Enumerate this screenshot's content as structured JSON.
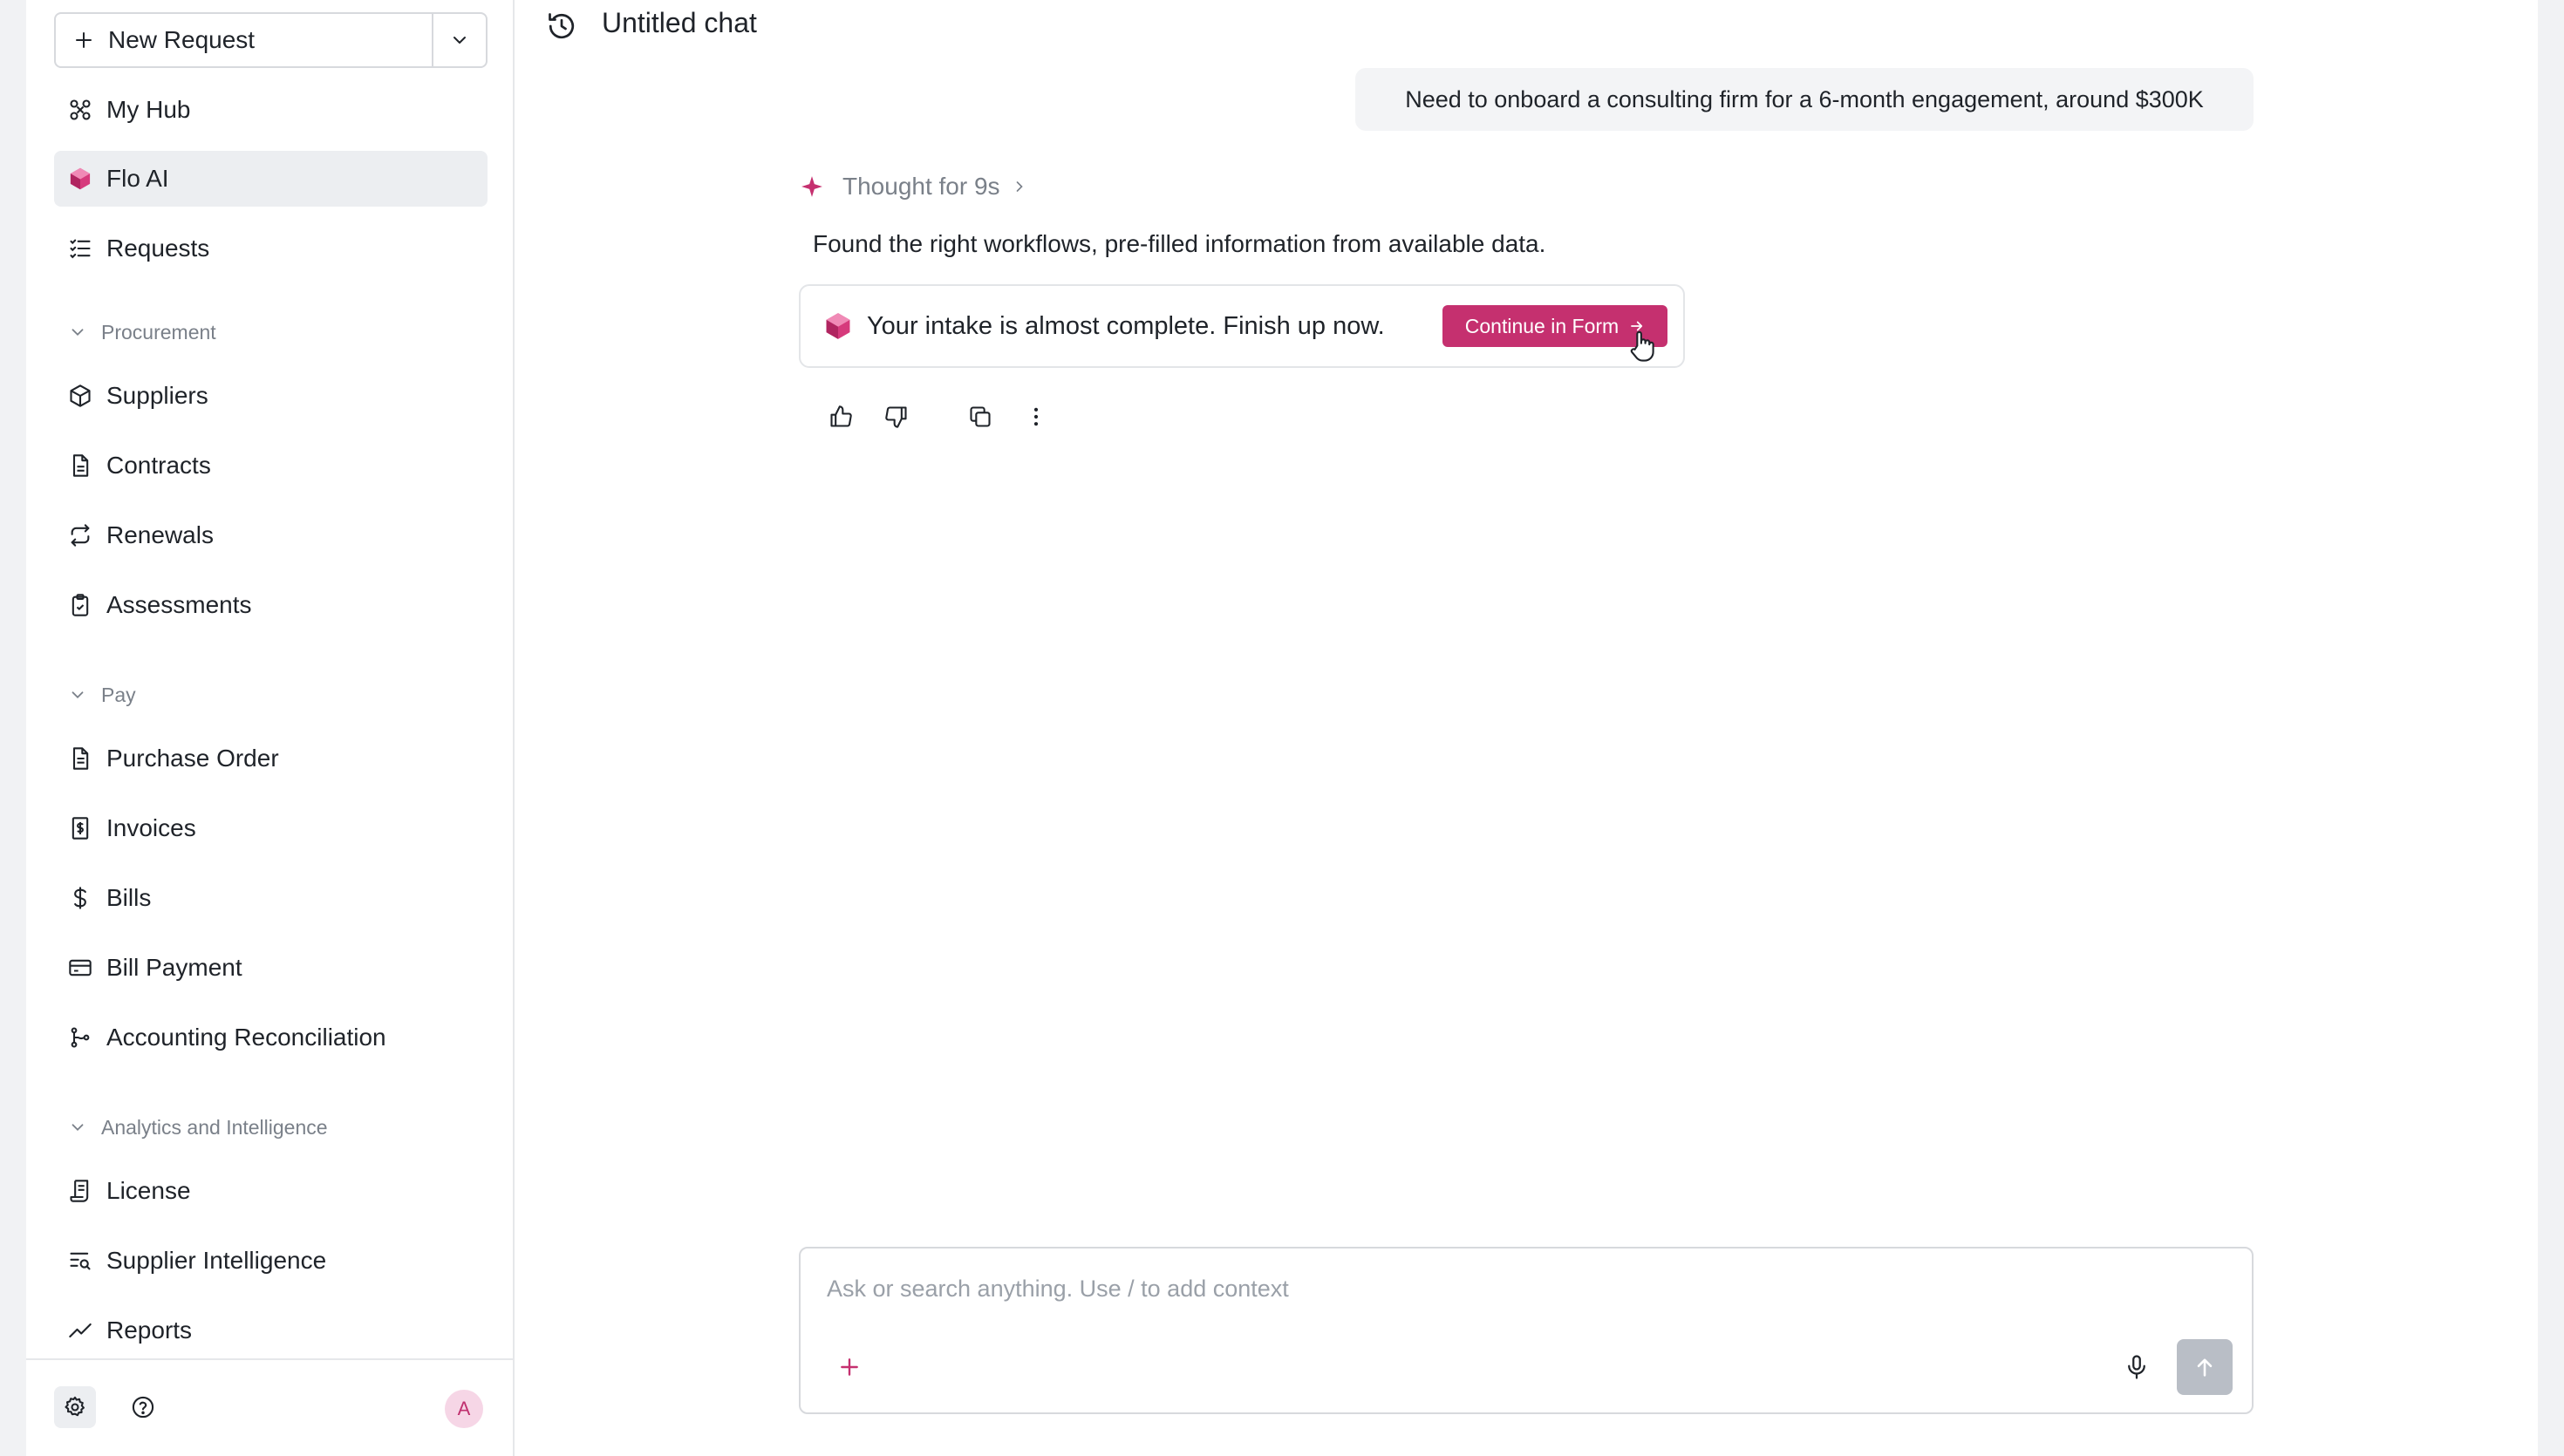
{
  "sidebar": {
    "new_request_label": "New Request",
    "items": {
      "my_hub": "My Hub",
      "flo_ai": "Flo AI",
      "requests": "Requests",
      "suppliers": "Suppliers",
      "contracts": "Contracts",
      "renewals": "Renewals",
      "assessments": "Assessments",
      "purchase_order": "Purchase Order",
      "invoices": "Invoices",
      "bills": "Bills",
      "bill_payment": "Bill Payment",
      "accounting_reconciliation": "Accounting Reconciliation",
      "license": "License",
      "supplier_intelligence": "Supplier Intelligence",
      "reports": "Reports"
    },
    "sections": {
      "procurement": "Procurement",
      "pay": "Pay",
      "analytics": "Analytics and Intelligence"
    },
    "active_item": "Flo AI",
    "avatar_initial": "A"
  },
  "chat": {
    "title": "Untitled chat",
    "user_message": "Need to onboard a consulting firm for a 6-month engagement, around $300K",
    "thought_label": "Thought for 9s",
    "answer": "Found the right workflows, pre-filled information from available data.",
    "intake_text": "Your intake is almost complete. Finish up now.",
    "continue_label": "Continue in Form"
  },
  "composer": {
    "placeholder": "Ask or search anything. Use / to add context"
  },
  "colors": {
    "accent": "#c5306f",
    "sidebar_active": "#eceef1",
    "send_disabled": "#b9bec6"
  }
}
